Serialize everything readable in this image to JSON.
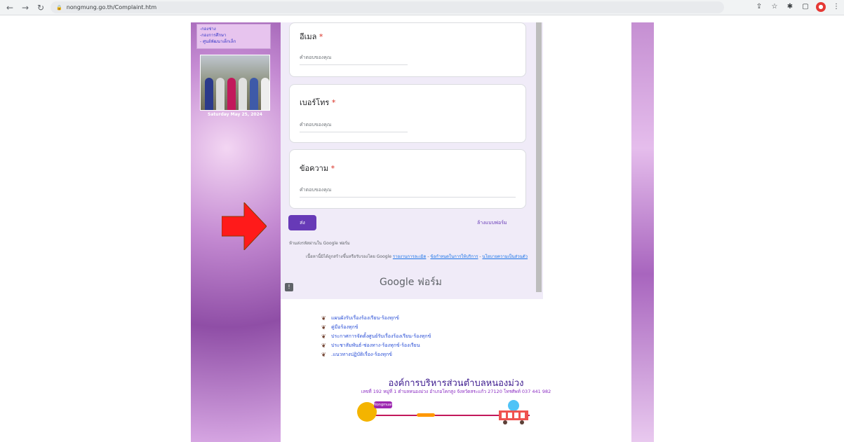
{
  "browser": {
    "url": "nongmung.go.th/Complaint.htm",
    "back_icon": "back-arrow-icon",
    "forward_icon": "forward-arrow-icon",
    "reload_icon": "reload-icon"
  },
  "sidebar": {
    "nav_links": [
      "-กองช่าง",
      "-กองการศึกษา",
      "- ศูนย์พัฒนาเด็กเล็ก"
    ],
    "date_caption": "Saturday May 25, 2024"
  },
  "form": {
    "questions": [
      {
        "label": "อีเมล",
        "required_mark": "*",
        "placeholder": "คำตอบของคุณ"
      },
      {
        "label": "เบอร์โทร",
        "required_mark": "*",
        "placeholder": "คำตอบของคุณ"
      },
      {
        "label": "ข้อความ",
        "required_mark": "*",
        "placeholder": "คำตอบของคุณ"
      }
    ],
    "submit_label": "ส่ง",
    "clear_label": "ล้างแบบฟอร์ม",
    "note_password": "ห้ามส่งรหัสผ่านใน Google ฟอร์ม",
    "note_content_prefix": "เนื้อหานี้มิได้ถูกสร้างขึ้นหรือรับรองโดย Google",
    "note_link_report": "รายงานการละเมิด",
    "note_link_terms": "ข้อกำหนดในการให้บริการ",
    "note_link_privacy": "นโยบายความเป็นส่วนตัว",
    "google_forms_logo": "Google ฟอร์ม",
    "accent_color": "#673ab7"
  },
  "links": [
    "แผนผังรับเรื่องร้องเรียน-ร้องทุกข์",
    "คู่มือร้องทุกข์",
    "ประกาศการจัดตั้งศูนย์รับเรื่องร้องเรียน-ร้องทุกข์",
    "ประชาสัมพันธ์-ช่องทาง-ร้องทุกข์-ร้องเรียน",
    ".แนวทางปฏิบัติเรื่อง-ร้องทุกข์"
  ],
  "footer": {
    "org_name": "องค์การบริหารส่วนตำบลหนองม่วง",
    "address": "เลขที่ 192 หมู่ที่ 1 ตำบลหนองม่วง อำเภอโคกสูง จังหวัดสระแก้ว 27120 โทรศัพท์ 037 441 982",
    "tag_text": "Nongmuang"
  }
}
